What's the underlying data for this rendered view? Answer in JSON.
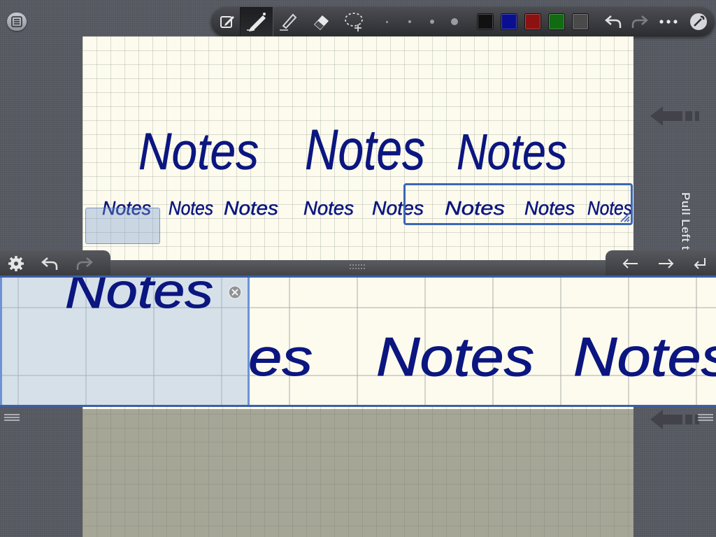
{
  "toolbar": {
    "tools": [
      "edit-icon",
      "pen-icon",
      "highlighter-icon",
      "eraser-icon",
      "lasso-icon"
    ],
    "active_tool": "pen-icon",
    "pen_sizes": 4,
    "colors": [
      "#111111",
      "#0a0f8f",
      "#8c1212",
      "#126a12",
      "#4a4a4a"
    ]
  },
  "canvas": {
    "large_word": "Notes",
    "small_word": "Notes"
  },
  "side_panel": {
    "pull_label": "Pull Left to A"
  },
  "zoom_pane": {
    "word": "Notes",
    "partial_word": "es"
  },
  "icons": {
    "settings": "gear-icon",
    "undo": "undo-icon",
    "redo": "redo-icon",
    "prev": "arrow-left-icon",
    "next": "arrow-right-icon",
    "newline": "return-icon"
  }
}
